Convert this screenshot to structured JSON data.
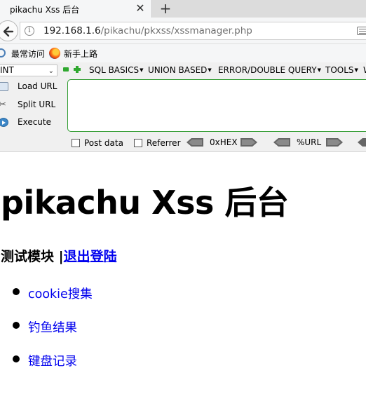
{
  "browser": {
    "tab_title": "pikachu Xss 后台",
    "close_glyph": "✕",
    "new_tab_glyph": "+",
    "url_host": "192.168.1.6",
    "url_path": "/pikachu/pkxss/xssmanager.php",
    "bookmarks": [
      "最常访问",
      "新手上路"
    ]
  },
  "hackbar": {
    "select_value": "INT",
    "menus": [
      "SQL BASICS",
      "UNION BASED",
      "ERROR/DOUBLE QUERY",
      "TOOLS",
      "W"
    ],
    "actions": [
      "Load URL",
      "Split URL",
      "Execute"
    ],
    "checkboxes": [
      "Post data",
      "Referrer"
    ],
    "encoders": [
      "0xHEX",
      "%URL"
    ]
  },
  "page": {
    "title": "pikachu Xss 后台",
    "subhead_label": "测试模块 |",
    "logout_link": "退出登陆",
    "menu_items": [
      "cookie搜集",
      "钓鱼结果",
      "键盘记录"
    ]
  },
  "colors": {
    "link": "#0000ee",
    "hackbar_accent": "#2f9b2f"
  }
}
